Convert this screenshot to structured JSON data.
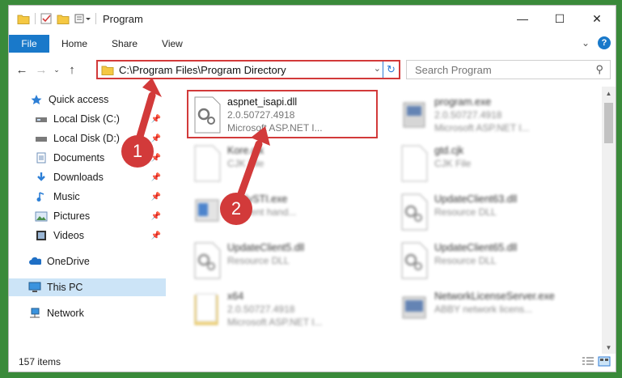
{
  "window": {
    "title": "Program"
  },
  "ribbon": {
    "file": "File",
    "tabs": [
      "Home",
      "Share",
      "View"
    ]
  },
  "nav": {
    "address": "C:\\Program Files\\Program Directory",
    "search_placeholder": "Search Program"
  },
  "sidebar": {
    "items": [
      {
        "label": "Quick access",
        "icon": "star-icon"
      },
      {
        "label": "Local Disk (C:)",
        "icon": "drive-icon",
        "pinned": true
      },
      {
        "label": "Local Disk (D:)",
        "icon": "drive-icon",
        "pinned": true
      },
      {
        "label": "Documents",
        "icon": "documents-icon",
        "pinned": true
      },
      {
        "label": "Downloads",
        "icon": "download-icon",
        "pinned": true
      },
      {
        "label": "Music",
        "icon": "music-icon",
        "pinned": true
      },
      {
        "label": "Pictures",
        "icon": "pictures-icon",
        "pinned": true
      },
      {
        "label": "Videos",
        "icon": "videos-icon",
        "pinned": true
      },
      {
        "label": "OneDrive",
        "icon": "cloud-icon"
      },
      {
        "label": "This PC",
        "icon": "computer-icon",
        "selected": true
      },
      {
        "label": "Network",
        "icon": "network-icon"
      }
    ]
  },
  "files": [
    {
      "name": "aspnet_isapi.dll",
      "line1": "2.0.50727.4918",
      "line2": "Microsoft ASP.NET I...",
      "highlighted": true
    },
    {
      "name": "program.exe",
      "line1": "2.0.50727.4918",
      "line2": "Microsoft ASP.NET I..."
    },
    {
      "name": "Kore.cjk",
      "line1": "CJK File",
      "line2": ""
    },
    {
      "name": "gtd.cjk",
      "line1": "CJK File",
      "line2": ""
    },
    {
      "name": "ApplySTI.exe",
      "line1": "sh event hand...",
      "line2": ""
    },
    {
      "name": "UpdateClient63.dll",
      "line1": "Resource DLL",
      "line2": ""
    },
    {
      "name": "UpdateClient5.dll",
      "line1": "Resource DLL",
      "line2": ""
    },
    {
      "name": "UpdateClient65.dll",
      "line1": "Resource DLL",
      "line2": ""
    },
    {
      "name": "x64",
      "line1": "2.0.50727.4918",
      "line2": "Microsoft ASP.NET I..."
    },
    {
      "name": "NetworkLicenseServer.exe",
      "line1": "ABBY network licens...",
      "line2": ""
    }
  ],
  "status": {
    "count": "157 items"
  },
  "annotations": {
    "step1": "1",
    "step2": "2"
  },
  "colors": {
    "accent": "#1979ca",
    "highlight": "#d23a3a",
    "selected": "#cce4f7"
  }
}
